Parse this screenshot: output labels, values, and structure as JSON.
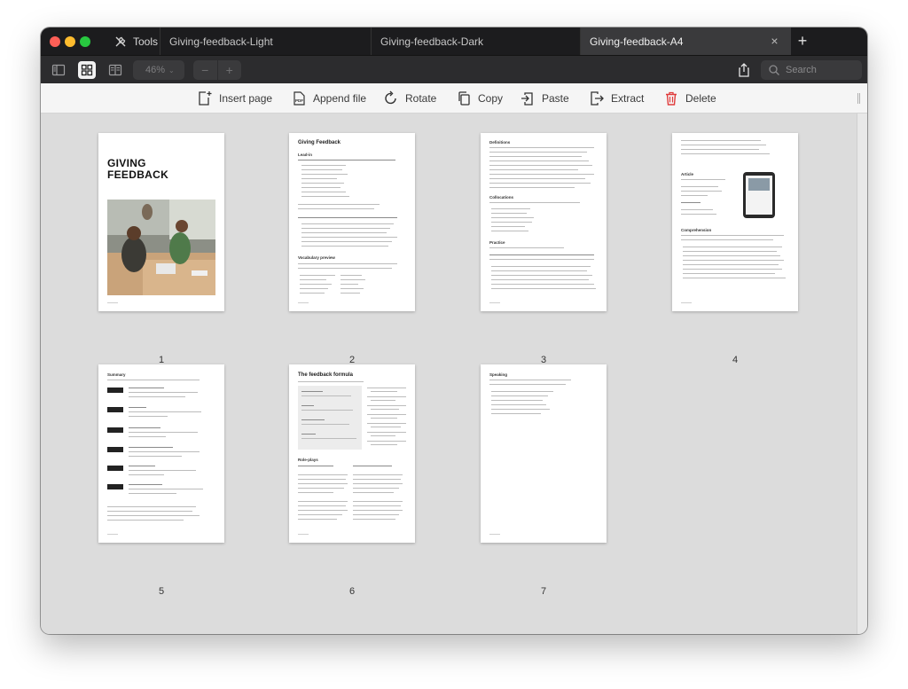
{
  "window": {
    "tools_label": "Tools",
    "tabs": [
      {
        "label": "Giving-feedback-Light",
        "active": false
      },
      {
        "label": "Giving-feedback-Dark",
        "active": false
      },
      {
        "label": "Giving-feedback-A4",
        "active": true
      }
    ],
    "close_tab_glyph": "×",
    "new_tab_glyph": "+"
  },
  "toolbar": {
    "zoom_value": "46%",
    "zoom_minus": "−",
    "zoom_plus": "+",
    "search_placeholder": "Search",
    "view_buttons": [
      "sidebar-icon",
      "grid-view-icon",
      "page-view-icon"
    ],
    "active_view": "grid-view-icon"
  },
  "actions": [
    {
      "label": "Insert page",
      "icon": "insert-page-icon"
    },
    {
      "label": "Append file",
      "icon": "append-pdf-icon"
    },
    {
      "label": "Rotate",
      "icon": "rotate-icon"
    },
    {
      "label": "Copy",
      "icon": "copy-icon"
    },
    {
      "label": "Paste",
      "icon": "paste-icon"
    },
    {
      "label": "Extract",
      "icon": "extract-icon"
    },
    {
      "label": "Delete",
      "icon": "trash-icon",
      "color": "#e03c3c"
    }
  ],
  "pages": [
    {
      "number": "1",
      "title": "GIVING FEEDBACK"
    },
    {
      "number": "2",
      "title": "Giving Feedback",
      "headings": [
        "Lead-in",
        "Vocabulary preview"
      ]
    },
    {
      "number": "3",
      "headings": [
        "Definitions",
        "Collocations",
        "Practice"
      ]
    },
    {
      "number": "4",
      "headings": [
        "Article",
        "Comprehension"
      ]
    },
    {
      "number": "5",
      "headings": [
        "Summary"
      ]
    },
    {
      "number": "6",
      "title": "The feedback formula",
      "headings": [
        "Role-plays"
      ]
    },
    {
      "number": "7",
      "headings": [
        "Speaking"
      ]
    }
  ],
  "colors": {
    "titlebar": "#1c1c1e",
    "toolbar": "#2c2c2e",
    "actionbar": "#f5f5f5",
    "canvas": "#dcdcdc",
    "delete_accent": "#e03c3c"
  }
}
